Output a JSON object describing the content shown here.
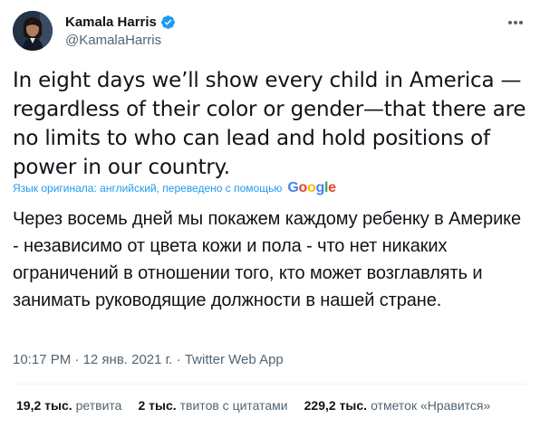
{
  "author": {
    "display_name": "Kamala Harris",
    "handle": "@KamalaHarris",
    "verified": true,
    "verified_color": "#1d9bf0"
  },
  "tweet": {
    "text": "In eight days we’ll show every child in America —regardless of their color or gender—that there are no limits to who can lead and hold positions of power in our country.",
    "translation_note": "Язык оригинала: английский, переведено с помощью",
    "translation": "Через восемь дней мы покажем каждому ребенку в Америке - независимо от цвета кожи и пола - что нет никаких ограничений в отношении того, кто может возглавлять и занимать руководящие должности в нашей стране."
  },
  "meta": {
    "time": "10:17 PM",
    "date": "12 янв. 2021 г.",
    "source": "Twitter Web App"
  },
  "stats": {
    "retweets_value": "19,2 тыс.",
    "retweets_label": "ретвита",
    "quotes_value": "2 тыс.",
    "quotes_label": "твитов с цитатами",
    "likes_value": "229,2 тыс.",
    "likes_label": "отметок «Нравится»"
  },
  "icons": {
    "more": "more-horizontal-icon",
    "verified": "verified-badge-icon",
    "google": "google-logo"
  }
}
